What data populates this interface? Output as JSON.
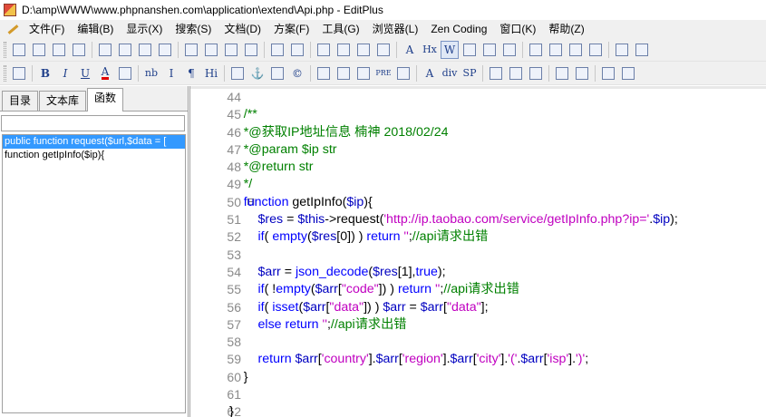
{
  "window": {
    "title": "D:\\amp\\WWW\\www.phpnanshen.com\\application\\extend\\Api.php - EditPlus"
  },
  "menu": [
    "文件(F)",
    "编辑(B)",
    "显示(X)",
    "搜索(S)",
    "文档(D)",
    "方案(F)",
    "工具(G)",
    "浏览器(L)",
    "Zen Coding",
    "窗口(K)",
    "帮助(Z)"
  ],
  "toolbar1": [
    {
      "name": "new-file-icon",
      "glyph": ""
    },
    {
      "name": "open-file-icon",
      "glyph": ""
    },
    {
      "name": "save-icon",
      "glyph": ""
    },
    {
      "name": "save-all-icon",
      "glyph": ""
    },
    {
      "name": "sep"
    },
    {
      "name": "print-icon",
      "glyph": ""
    },
    {
      "name": "print-preview-icon",
      "glyph": ""
    },
    {
      "name": "spellcheck-icon",
      "glyph": ""
    },
    {
      "name": "check-icon",
      "glyph": ""
    },
    {
      "name": "sep"
    },
    {
      "name": "cut-icon",
      "glyph": ""
    },
    {
      "name": "copy-icon",
      "glyph": ""
    },
    {
      "name": "paste-icon",
      "glyph": ""
    },
    {
      "name": "delete-icon",
      "glyph": ""
    },
    {
      "name": "sep"
    },
    {
      "name": "undo-icon",
      "glyph": ""
    },
    {
      "name": "redo-icon",
      "glyph": ""
    },
    {
      "name": "sep"
    },
    {
      "name": "find-icon",
      "glyph": ""
    },
    {
      "name": "replace-icon",
      "glyph": ""
    },
    {
      "name": "find-in-files-icon",
      "glyph": ""
    },
    {
      "name": "goto-icon",
      "glyph": ""
    },
    {
      "name": "sep"
    },
    {
      "name": "font-icon",
      "glyph": "A"
    },
    {
      "name": "hx-icon",
      "glyph": "Hx"
    },
    {
      "name": "word-wrap-icon",
      "glyph": "W"
    },
    {
      "name": "line-number-icon",
      "glyph": ""
    },
    {
      "name": "column-icon",
      "glyph": ""
    },
    {
      "name": "spell-icon",
      "glyph": ""
    },
    {
      "name": "sep"
    },
    {
      "name": "doc-selector-icon",
      "glyph": ""
    },
    {
      "name": "directory-icon",
      "glyph": ""
    },
    {
      "name": "cliptext-icon",
      "glyph": ""
    },
    {
      "name": "output-icon",
      "glyph": ""
    },
    {
      "name": "sep"
    },
    {
      "name": "pointer-icon",
      "glyph": ""
    },
    {
      "name": "window-icon",
      "glyph": ""
    }
  ],
  "toolbar2": [
    {
      "name": "browser-icon",
      "glyph": ""
    },
    {
      "name": "sep"
    },
    {
      "name": "bold-icon",
      "glyph": "B"
    },
    {
      "name": "italic-icon",
      "glyph": "I"
    },
    {
      "name": "underline-icon",
      "glyph": "U"
    },
    {
      "name": "font-color-icon",
      "glyph": "A"
    },
    {
      "name": "color-grid-icon",
      "glyph": ""
    },
    {
      "name": "sep"
    },
    {
      "name": "nbsp-icon",
      "glyph": "nb"
    },
    {
      "name": "break-icon",
      "glyph": "I"
    },
    {
      "name": "paragraph-icon",
      "glyph": "¶"
    },
    {
      "name": "heading-icon",
      "glyph": "Hi"
    },
    {
      "name": "sep"
    },
    {
      "name": "image-icon",
      "glyph": ""
    },
    {
      "name": "anchor-icon",
      "glyph": "⚓"
    },
    {
      "name": "link-icon",
      "glyph": ""
    },
    {
      "name": "copyright-icon",
      "glyph": "©"
    },
    {
      "name": "sep"
    },
    {
      "name": "table-icon",
      "glyph": ""
    },
    {
      "name": "form-icon",
      "glyph": ""
    },
    {
      "name": "hr-icon",
      "glyph": ""
    },
    {
      "name": "pre-icon",
      "glyph": "PRE"
    },
    {
      "name": "list-icon",
      "glyph": ""
    },
    {
      "name": "sep"
    },
    {
      "name": "text-a-icon",
      "glyph": "A"
    },
    {
      "name": "div-icon",
      "glyph": "div"
    },
    {
      "name": "span-icon",
      "glyph": "SP"
    },
    {
      "name": "sep"
    },
    {
      "name": "edit-html-icon",
      "glyph": ""
    },
    {
      "name": "highlight-icon",
      "glyph": ""
    },
    {
      "name": "tools-icon",
      "glyph": ""
    },
    {
      "name": "sep"
    },
    {
      "name": "panel-icon",
      "glyph": ""
    },
    {
      "name": "grid-icon",
      "glyph": ""
    },
    {
      "name": "sep"
    },
    {
      "name": "color-picker-icon",
      "glyph": ""
    },
    {
      "name": "frame-icon",
      "glyph": ""
    }
  ],
  "sidebar": {
    "tabs": [
      "目录",
      "文本库",
      "函数"
    ],
    "active_tab": 2,
    "functions": [
      "public function request($url,$data = [",
      "function getIpInfo($ip){"
    ]
  },
  "editor": {
    "lines": [
      {
        "n": "44",
        "fold": "",
        "segs": []
      },
      {
        "n": "45",
        "fold": "",
        "segs": [
          [
            "c-comment",
            "    /**"
          ]
        ]
      },
      {
        "n": "46",
        "fold": "",
        "segs": [
          [
            "c-comment",
            "    *@获取IP地址信息 楠神 2018/02/24"
          ]
        ]
      },
      {
        "n": "47",
        "fold": "",
        "segs": [
          [
            "c-comment",
            "    *@param $ip str"
          ]
        ]
      },
      {
        "n": "48",
        "fold": "",
        "segs": [
          [
            "c-comment",
            "    *@return str"
          ]
        ]
      },
      {
        "n": "49",
        "fold": "",
        "segs": [
          [
            "c-comment",
            "    */"
          ]
        ]
      },
      {
        "n": "50",
        "fold": "⊟",
        "segs": [
          [
            "c-kw",
            "    function "
          ],
          [
            "c-plain",
            "getIpInfo("
          ],
          [
            "c-var",
            "$ip"
          ],
          [
            "c-plain",
            "){"
          ]
        ]
      },
      {
        "n": "51",
        "fold": "",
        "segs": [
          [
            "c-var",
            "        $res"
          ],
          [
            "c-plain",
            " = "
          ],
          [
            "c-var",
            "$this"
          ],
          [
            "c-plain",
            "->request("
          ],
          [
            "c-str",
            "'http://ip.taobao.com/service/getIpInfo.php?ip='"
          ],
          [
            "c-plain",
            "."
          ],
          [
            "c-var",
            "$ip"
          ],
          [
            "c-plain",
            ");"
          ]
        ]
      },
      {
        "n": "52",
        "fold": "",
        "segs": [
          [
            "c-kw",
            "        if"
          ],
          [
            "c-plain",
            "( "
          ],
          [
            "c-kw",
            "empty"
          ],
          [
            "c-plain",
            "("
          ],
          [
            "c-var",
            "$res"
          ],
          [
            "c-plain",
            "[0]) ) "
          ],
          [
            "c-kw",
            "return "
          ],
          [
            "c-str",
            "''"
          ],
          [
            "c-plain",
            ";"
          ],
          [
            "c-comment",
            "//api请求出错"
          ]
        ]
      },
      {
        "n": "53",
        "fold": "",
        "segs": []
      },
      {
        "n": "54",
        "fold": "",
        "segs": [
          [
            "c-var",
            "        $arr"
          ],
          [
            "c-plain",
            " = "
          ],
          [
            "c-kw",
            "json_decode"
          ],
          [
            "c-plain",
            "("
          ],
          [
            "c-var",
            "$res"
          ],
          [
            "c-plain",
            "[1],"
          ],
          [
            "c-kw",
            "true"
          ],
          [
            "c-plain",
            ");"
          ]
        ]
      },
      {
        "n": "55",
        "fold": "",
        "segs": [
          [
            "c-kw",
            "        if"
          ],
          [
            "c-plain",
            "( !"
          ],
          [
            "c-kw",
            "empty"
          ],
          [
            "c-plain",
            "("
          ],
          [
            "c-var",
            "$arr"
          ],
          [
            "c-plain",
            "["
          ],
          [
            "c-str",
            "\"code\""
          ],
          [
            "c-plain",
            "]) ) "
          ],
          [
            "c-kw",
            "return "
          ],
          [
            "c-str",
            "''"
          ],
          [
            "c-plain",
            ";"
          ],
          [
            "c-comment",
            "//api请求出错"
          ]
        ]
      },
      {
        "n": "56",
        "fold": "",
        "segs": [
          [
            "c-kw",
            "        if"
          ],
          [
            "c-plain",
            "( "
          ],
          [
            "c-kw",
            "isset"
          ],
          [
            "c-plain",
            "("
          ],
          [
            "c-var",
            "$arr"
          ],
          [
            "c-plain",
            "["
          ],
          [
            "c-str",
            "\"data\""
          ],
          [
            "c-plain",
            "]) ) "
          ],
          [
            "c-var",
            "$arr"
          ],
          [
            "c-plain",
            " = "
          ],
          [
            "c-var",
            "$arr"
          ],
          [
            "c-plain",
            "["
          ],
          [
            "c-str",
            "\"data\""
          ],
          [
            "c-plain",
            "];"
          ]
        ]
      },
      {
        "n": "57",
        "fold": "",
        "segs": [
          [
            "c-kw",
            "        else return "
          ],
          [
            "c-str",
            "''"
          ],
          [
            "c-plain",
            ";"
          ],
          [
            "c-comment",
            "//api请求出错"
          ]
        ]
      },
      {
        "n": "58",
        "fold": "",
        "segs": []
      },
      {
        "n": "59",
        "fold": "",
        "segs": [
          [
            "c-kw",
            "        return "
          ],
          [
            "c-var",
            "$arr"
          ],
          [
            "c-plain",
            "["
          ],
          [
            "c-str",
            "'country'"
          ],
          [
            "c-plain",
            "]."
          ],
          [
            "c-var",
            "$arr"
          ],
          [
            "c-plain",
            "["
          ],
          [
            "c-str",
            "'region'"
          ],
          [
            "c-plain",
            "]."
          ],
          [
            "c-var",
            "$arr"
          ],
          [
            "c-plain",
            "["
          ],
          [
            "c-str",
            "'city'"
          ],
          [
            "c-plain",
            "]."
          ],
          [
            "c-str",
            "'('"
          ],
          [
            "c-plain",
            "."
          ],
          [
            "c-var",
            "$arr"
          ],
          [
            "c-plain",
            "["
          ],
          [
            "c-str",
            "'isp'"
          ],
          [
            "c-plain",
            "]."
          ],
          [
            "c-str",
            "')'"
          ],
          [
            "c-plain",
            ";"
          ]
        ]
      },
      {
        "n": "60",
        "fold": "",
        "segs": [
          [
            "c-plain",
            "    }"
          ]
        ]
      },
      {
        "n": "61",
        "fold": "",
        "segs": []
      },
      {
        "n": "62",
        "fold": "",
        "segs": [
          [
            "c-plain",
            "}"
          ]
        ]
      }
    ]
  }
}
